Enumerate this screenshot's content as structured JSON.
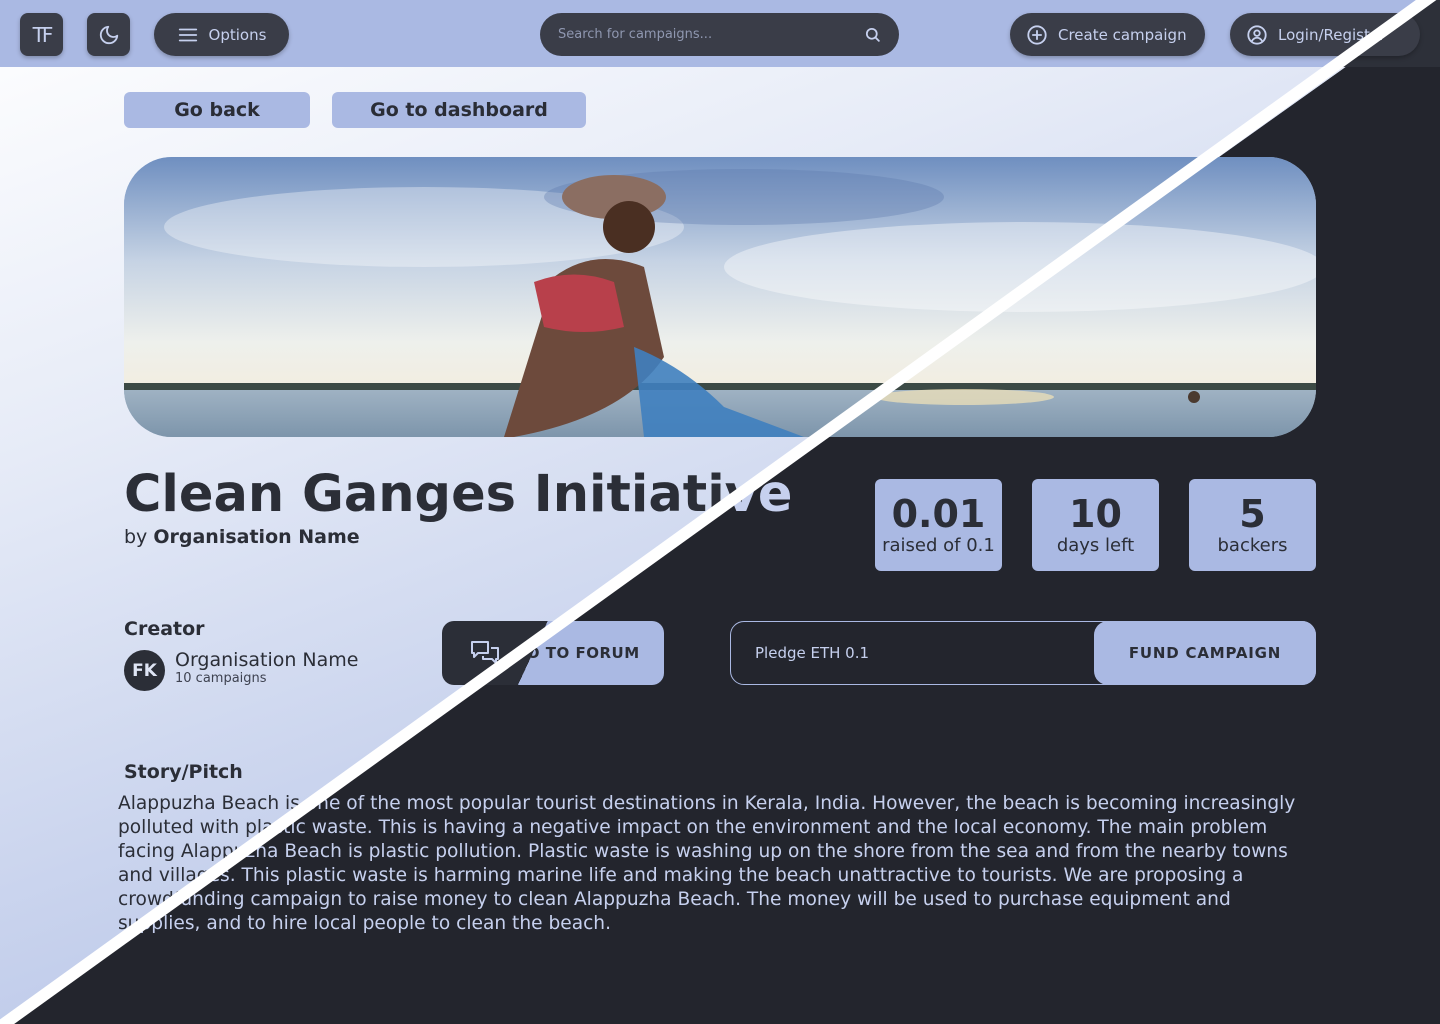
{
  "header": {
    "logo": "TF",
    "theme_icon": "moon-icon",
    "options_label": "Options",
    "search_placeholder": "Search for campaigns...",
    "create_label": "Create campaign",
    "login_label": "Login/Register"
  },
  "nav": {
    "back_label": "Go back",
    "dashboard_label": "Go to dashboard"
  },
  "campaign": {
    "title": "Clean Ganges Initiative",
    "by_prefix": "by",
    "organisation": "Organisation Name",
    "stats": [
      {
        "value": "0.01",
        "label": "raised of 0.1"
      },
      {
        "value": "10",
        "label": "days left"
      },
      {
        "value": "5",
        "label": "backers"
      }
    ]
  },
  "creator": {
    "heading": "Creator",
    "initials": "FK",
    "name": "Organisation Name",
    "campaigns": "10 campaigns"
  },
  "actions": {
    "forum_label": "GO TO FORUM",
    "pledge_placeholder": "Pledge ETH 0.1",
    "fund_label": "FUND CAMPAIGN"
  },
  "story": {
    "heading": "Story/Pitch",
    "text": "Alappuzha Beach is one of the most popular tourist destinations in Kerala, India. However, the beach is becoming increasingly polluted with plastic waste. This is having a negative impact on the environment and the local economy. The main problem facing Alappuzha Beach is plastic pollution. Plastic waste is washing up on the shore from the sea and from the nearby towns and villages. This plastic waste is harming marine life and making the beach unattractive to tourists. We are proposing a crowdfunding campaign to raise money to clean Alappuzha Beach. The money will be used to purchase equipment and supplies, and to hire local people to clean the beach."
  },
  "colors": {
    "accent": "#aab9e3",
    "dark": "#23252d",
    "text_dark": "#2b2e37"
  }
}
